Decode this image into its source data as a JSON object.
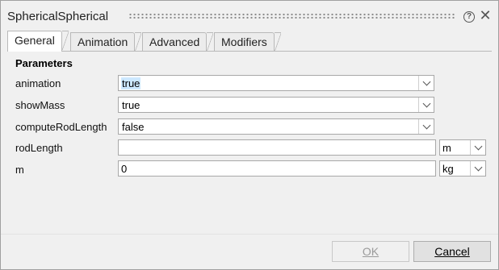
{
  "window": {
    "title": "SphericalSpherical"
  },
  "tabs": [
    {
      "label": "General",
      "active": true
    },
    {
      "label": "Animation",
      "active": false
    },
    {
      "label": "Advanced",
      "active": false
    },
    {
      "label": "Modifiers",
      "active": false
    }
  ],
  "parameters": {
    "section_title": "Parameters",
    "rows": [
      {
        "label": "animation",
        "value": "true",
        "control": "dropdown"
      },
      {
        "label": "showMass",
        "value": "true",
        "control": "dropdown"
      },
      {
        "label": "computeRodLength",
        "value": "false",
        "control": "dropdown"
      },
      {
        "label": "rodLength",
        "value": "",
        "control": "text",
        "unit": "m"
      },
      {
        "label": "m",
        "value": "0",
        "control": "text",
        "unit": "kg"
      }
    ]
  },
  "buttons": {
    "ok_label": "OK",
    "cancel_label": "Cancel"
  },
  "icons": {
    "help": "help-icon",
    "close": "close-icon",
    "dropdown": "chevron-down-icon"
  },
  "help_glyph": "?",
  "close_glyph": "✕"
}
